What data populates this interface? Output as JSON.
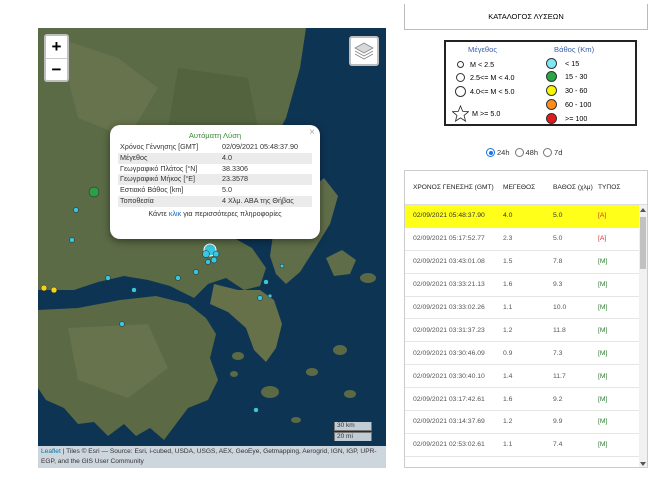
{
  "map": {
    "zoom_in": "+",
    "zoom_out": "−",
    "layers_icon": "layers-icon",
    "scale_km": "30 km",
    "scale_mi": "20 mi",
    "attribution_link": "Leaflet",
    "attribution_text": " | Tiles © Esri — Source: Esri, i-cubed, USDA, USGS, AEX, GeoEye, Getmapping, Aerogrid, IGN, IGP, UPR-EGP, and the GIS User Community",
    "colors": {
      "sea": "#0e3454",
      "land": "#5a6a44",
      "marker_cyan": "#38c7e0",
      "marker_green": "#2e9e45",
      "marker_yellow": "#f2d21c"
    }
  },
  "popup": {
    "close": "×",
    "title": "Αυτόματη Λύση",
    "rows": [
      {
        "k": "Χρόνος Γέννησης [GMT]",
        "v": "02/09/2021 05:48:37.90"
      },
      {
        "k": "Μέγεθος",
        "v": "4.0"
      },
      {
        "k": "Γεωγραφικό Πλάτος [°N]",
        "v": "38.3306"
      },
      {
        "k": "Γεωγραφικό Μήκος [°E]",
        "v": "23.3578"
      },
      {
        "k": "Εστιακό Βάθος [km]",
        "v": "5.0"
      },
      {
        "k": "Τοποθεσία",
        "v": "4 Χλμ. ΑΒΑ της Θήβας"
      }
    ],
    "footer_pre": "Κάντε ",
    "footer_link": "κλικ",
    "footer_post": " για περισσότερες πληροφορίες"
  },
  "panel": {
    "title": "ΚΑΤΑΛΟΓΟΣ ΛΥΣΕΩΝ",
    "legend": {
      "mag_title": "Μέγεθος",
      "depth_title": "Βάθος (Km)",
      "mag_items": [
        "M < 2.5",
        "2.5<= M < 4.0",
        "4.0<= M < 5.0",
        "M >= 5.0"
      ],
      "depth_items": [
        {
          "label": "< 15",
          "color": "#7fe8f2"
        },
        {
          "label": "15 - 30",
          "color": "#28a745"
        },
        {
          "label": "30 - 60",
          "color": "#f7f700"
        },
        {
          "label": "60 - 100",
          "color": "#ff8c1a"
        },
        {
          "label": ">= 100",
          "color": "#e01b1b"
        }
      ]
    },
    "radios": [
      "24h",
      "48h",
      "7d"
    ],
    "table": {
      "headers": [
        "ΧΡΟΝΟΣ ΓΕΝΕΣΗΣ (GMT)",
        "ΜΕΓΕΘΟΣ",
        "ΒΑΘΟΣ (χλμ)",
        "ΤΥΠΟΣ"
      ],
      "rows": [
        [
          "02/09/2021 05:48:37.90",
          "4.0",
          "5.0",
          "[A]"
        ],
        [
          "02/09/2021 05:17:52.77",
          "2.3",
          "5.0",
          "[A]"
        ],
        [
          "02/09/2021 03:43:01.08",
          "1.5",
          "7.8",
          "[M]"
        ],
        [
          "02/09/2021 03:33:21.13",
          "1.6",
          "9.3",
          "[M]"
        ],
        [
          "02/09/2021 03:33:02.26",
          "1.1",
          "10.0",
          "[M]"
        ],
        [
          "02/09/2021 03:31:37.23",
          "1.2",
          "11.8",
          "[M]"
        ],
        [
          "02/09/2021 03:30:46.09",
          "0.9",
          "7.3",
          "[M]"
        ],
        [
          "02/09/2021 03:30:40.10",
          "1.4",
          "11.7",
          "[M]"
        ],
        [
          "02/09/2021 03:17:42.61",
          "1.6",
          "9.2",
          "[M]"
        ],
        [
          "02/09/2021 03:14:37.69",
          "1.2",
          "9.9",
          "[M]"
        ],
        [
          "02/09/2021 02:53:02.61",
          "1.1",
          "7.4",
          "[M]"
        ]
      ]
    }
  }
}
